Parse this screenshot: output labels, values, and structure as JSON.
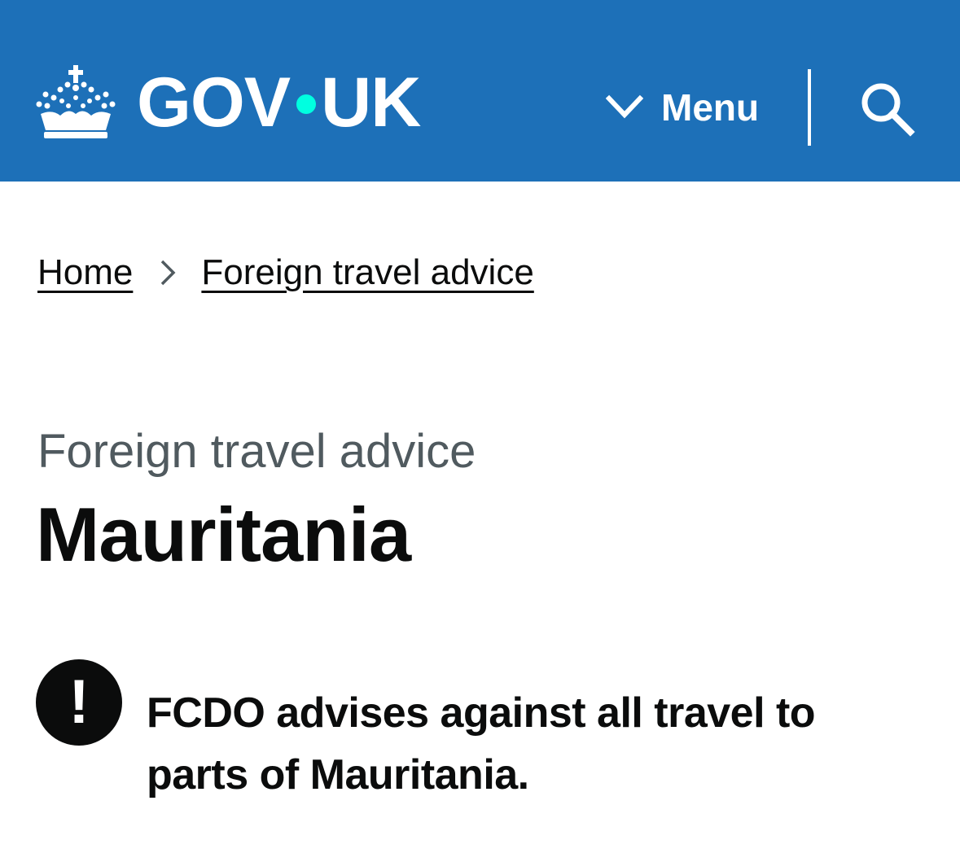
{
  "header": {
    "logo_text_left": "GOV",
    "logo_text_right": "UK",
    "logo_icon": "crown-icon",
    "menu_label": "Menu",
    "menu_icon": "chevron-down-icon",
    "search_icon": "search-icon",
    "background_color": "#1d70b8",
    "dot_color": "#00ffe0"
  },
  "breadcrumb": {
    "items": [
      {
        "label": "Home"
      },
      {
        "label": "Foreign travel advice"
      }
    ],
    "separator_icon": "chevron-right-icon"
  },
  "main": {
    "caption": "Foreign travel advice",
    "title": "Mauritania",
    "warning": {
      "icon": "exclamation-icon",
      "icon_text": "!",
      "text": "FCDO advises against all travel to parts of Mauritania."
    }
  }
}
